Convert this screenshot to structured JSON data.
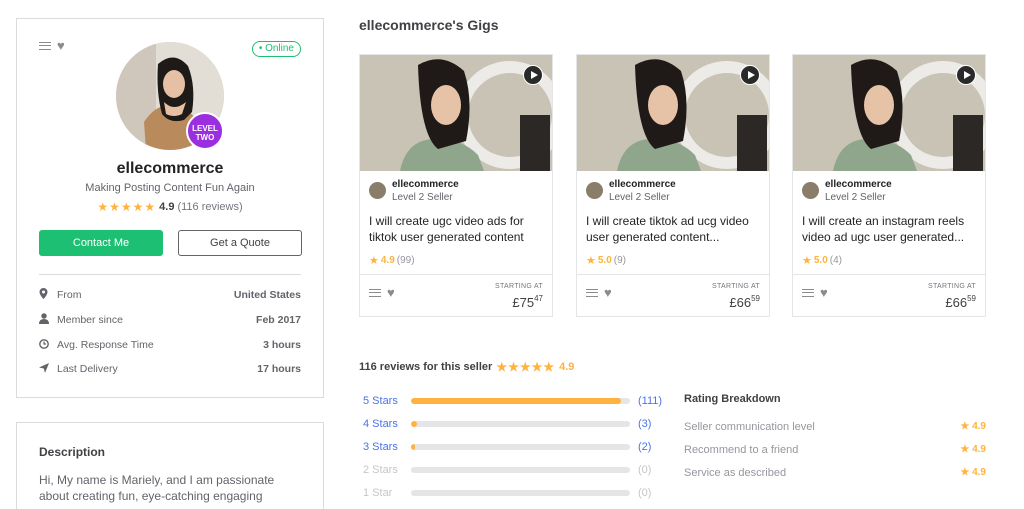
{
  "profile": {
    "online": "• Online",
    "level_badge_line1": "LEVEL",
    "level_badge_line2": "TWO",
    "username": "ellecommerce",
    "tagline": "Making Posting Content Fun Again",
    "stars": "★★★★★",
    "rating": "4.9",
    "reviews": "(116 reviews)",
    "contact_label": "Contact Me",
    "quote_label": "Get a Quote",
    "stats": [
      {
        "label": "From",
        "value": "United States",
        "icon": "location-pin-icon"
      },
      {
        "label": "Member since",
        "value": "Feb 2017",
        "icon": "user-icon"
      },
      {
        "label": "Avg. Response Time",
        "value": "3 hours",
        "icon": "clock-icon"
      },
      {
        "label": "Last Delivery",
        "value": "17 hours",
        "icon": "send-icon"
      }
    ]
  },
  "description": {
    "title": "Description",
    "text": "Hi,  My name is Mariely, and I am passionate about creating fun, eye-catching engaging"
  },
  "gigs": {
    "title": "ellecommerce's Gigs",
    "items": [
      {
        "seller": "ellecommerce",
        "level": "Level 2 Seller",
        "title": "I will create ugc video ads for tiktok user generated content",
        "star": "★",
        "rating": "4.9",
        "count": "(99)",
        "starting": "STARTING AT",
        "price_main": "£75",
        "price_cents": "47"
      },
      {
        "seller": "ellecommerce",
        "level": "Level 2 Seller",
        "title": "I will create tiktok ad ucg video user generated content...",
        "star": "★",
        "rating": "5.0",
        "count": "(9)",
        "starting": "STARTING AT",
        "price_main": "£66",
        "price_cents": "59"
      },
      {
        "seller": "ellecommerce",
        "level": "Level 2 Seller",
        "title": "I will create an instagram reels video ad ugc user generated...",
        "star": "★",
        "rating": "5.0",
        "count": "(4)",
        "starting": "STARTING AT",
        "price_main": "£66",
        "price_cents": "59"
      }
    ]
  },
  "reviews": {
    "title": "116 reviews for this seller",
    "stars": "★★★★★",
    "score": "4.9",
    "bars": [
      {
        "label": "5 Stars",
        "count": "(111)",
        "fraction": 0.957
      },
      {
        "label": "4 Stars",
        "count": "(3)",
        "fraction": 0.026
      },
      {
        "label": "3 Stars",
        "count": "(2)",
        "fraction": 0.017
      },
      {
        "label": "2 Stars",
        "count": "(0)",
        "fraction": 0
      },
      {
        "label": "1 Star",
        "count": "(0)",
        "fraction": 0
      }
    ],
    "breakdown_title": "Rating Breakdown",
    "breakdown": [
      {
        "label": "Seller communication level",
        "value": "★ 4.9"
      },
      {
        "label": "Recommend to a friend",
        "value": "★ 4.9"
      },
      {
        "label": "Service as described",
        "value": "★ 4.9"
      }
    ]
  },
  "colors": {
    "green": "#1dbf73",
    "star": "#ffb33e",
    "link_blue": "#4a73e8",
    "level_purple": "#9b2fe0"
  }
}
